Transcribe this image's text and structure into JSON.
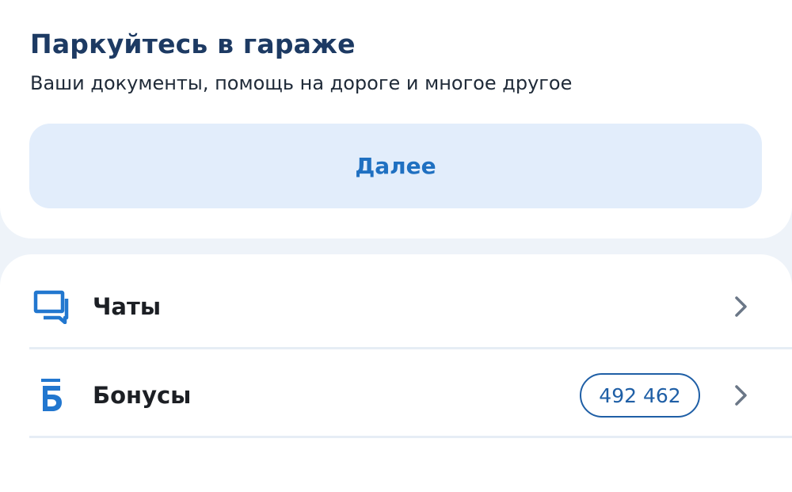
{
  "promo": {
    "title": "Паркуйтесь в гараже",
    "subtitle": "Ваши документы, помощь на дороге и многое другое",
    "next_label": "Далее"
  },
  "menu": {
    "items": [
      {
        "label": "Чаты",
        "icon": "chat-icon"
      },
      {
        "label": "Бонусы",
        "icon": "bonus-icon",
        "icon_glyph": "Б",
        "badge": "492 462"
      }
    ]
  },
  "colors": {
    "accent": "#1f70c1",
    "title": "#1d3a63",
    "button_bg": "#e2edfb",
    "page_bg": "#eef3f9"
  }
}
